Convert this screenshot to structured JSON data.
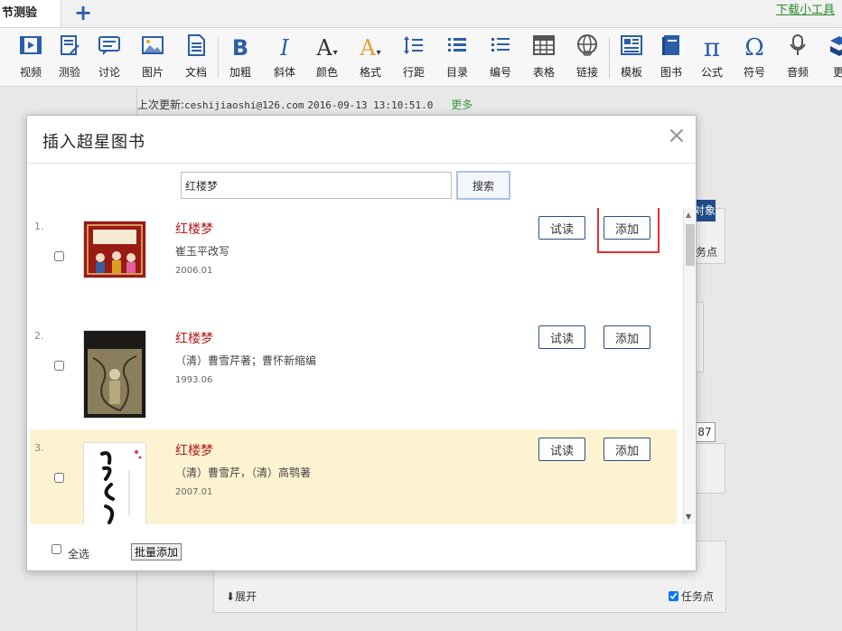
{
  "tab_bar": {
    "active_tab": "节测验",
    "download_link": "下载小工具"
  },
  "toolbar": {
    "items": [
      {
        "label": "视频",
        "icon": "video-icon"
      },
      {
        "label": "测验",
        "icon": "quiz-icon"
      },
      {
        "label": "讨论",
        "icon": "discussion-icon"
      },
      {
        "label": "图片",
        "icon": "image-icon"
      },
      {
        "label": "文档",
        "icon": "document-icon"
      },
      {
        "label": "加粗",
        "icon": "bold-icon",
        "glyph": "B"
      },
      {
        "label": "斜体",
        "icon": "italic-icon",
        "glyph": "I"
      },
      {
        "label": "颜色",
        "icon": "font-color-icon",
        "glyph": "A"
      },
      {
        "label": "格式",
        "icon": "format-icon",
        "glyph": "A"
      },
      {
        "label": "行距",
        "icon": "line-spacing-icon"
      },
      {
        "label": "目录",
        "icon": "toc-icon"
      },
      {
        "label": "编号",
        "icon": "numbered-list-icon"
      },
      {
        "label": "表格",
        "icon": "table-icon"
      },
      {
        "label": "链接",
        "icon": "link-icon"
      },
      {
        "label": "模板",
        "icon": "template-icon"
      },
      {
        "label": "图书",
        "icon": "book-icon"
      },
      {
        "label": "公式",
        "icon": "formula-icon",
        "glyph": "π"
      },
      {
        "label": "符号",
        "icon": "symbol-icon",
        "glyph": "Ω"
      },
      {
        "label": "音频",
        "icon": "audio-icon"
      },
      {
        "label": "更",
        "icon": "more-icon"
      }
    ]
  },
  "status": {
    "prefix": "上次更新:",
    "account": "ceshijiaoshi@126.com",
    "timestamp": "2016-09-13 13:10:51.0",
    "more": "更多"
  },
  "background": {
    "object_button": "对象",
    "task_point": "务点",
    "number_value": "87",
    "expand": "展开",
    "task_point_full": "任务点"
  },
  "dialog": {
    "title": "插入超星图书",
    "search": {
      "value": "红楼梦",
      "button": "搜索"
    },
    "results": [
      {
        "rank": "1.",
        "title": "红楼梦",
        "author": "崔玉平改写",
        "date": "2006.01",
        "try_label": "试读",
        "add_label": "添加",
        "highlighted": false
      },
      {
        "rank": "2.",
        "title": "红楼梦",
        "author": "（清）曹雪芹著；曹怀新缩编",
        "date": "1993.06",
        "try_label": "试读",
        "add_label": "添加",
        "highlighted": false
      },
      {
        "rank": "3.",
        "title": "红楼梦",
        "author": "（清）曹雪芹，（清）高鹗著",
        "date": "2007.01",
        "try_label": "试读",
        "add_label": "添加",
        "highlighted": true
      }
    ],
    "footer": {
      "select_all": "全选",
      "batch_add": "批量添加"
    }
  },
  "colors": {
    "accent": "#2a5ea8",
    "title_red": "#b01a1a",
    "highlight_row": "#fdf3d0",
    "annotation_red": "#e03030"
  }
}
